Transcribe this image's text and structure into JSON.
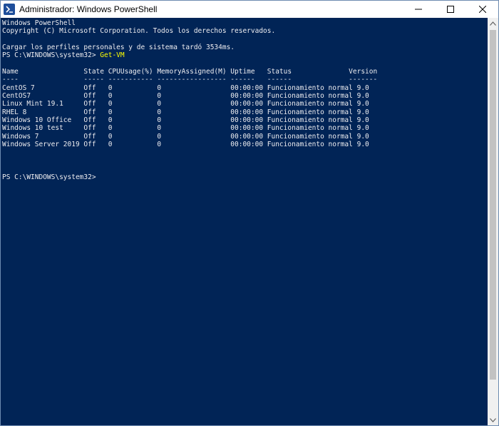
{
  "window": {
    "title": "Administrador: Windows PowerShell"
  },
  "icons": {
    "app": "powershell-icon",
    "minimize": "minimize-icon",
    "maximize": "maximize-icon",
    "close": "close-icon",
    "scroll_up": "chevron-up-icon",
    "scroll_down": "chevron-down-icon"
  },
  "colors": {
    "console_background": "#012456",
    "console_text": "#eeedf0",
    "command_text": "#ffff00"
  },
  "console": {
    "banner": [
      "Windows PowerShell",
      "Copyright (C) Microsoft Corporation. Todos los derechos reservados."
    ],
    "profile_message": "Cargar los perfiles personales y de sistema tardó 3534ms.",
    "prompt": "PS C:\\WINDOWS\\system32> ",
    "command": "Get-VM",
    "table": {
      "header": "Name                State CPUUsage(%) MemoryAssigned(M) Uptime   Status              Version",
      "separator": "----                ----- ----------- ----------------- ------   ------              -------",
      "rows": [
        "CentOS 7            Off   0           0                 00:00:00 Funcionamiento normal 9.0",
        "CentOS7             Off   0           0                 00:00:00 Funcionamiento normal 9.0",
        "Linux Mint 19.1     Off   0           0                 00:00:00 Funcionamiento normal 9.0",
        "RHEL 8              Off   0           0                 00:00:00 Funcionamiento normal 9.0",
        "Windows 10 Office   Off   0           0                 00:00:00 Funcionamiento normal 9.0",
        "Windows 10 test     Off   0           0                 00:00:00 Funcionamiento normal 9.0",
        "Windows 7           Off   0           0                 00:00:00 Funcionamiento normal 9.0",
        "Windows Server 2019 Off   0           0                 00:00:00 Funcionamiento normal 9.0"
      ]
    },
    "final_prompt": "PS C:\\WINDOWS\\system32>"
  }
}
